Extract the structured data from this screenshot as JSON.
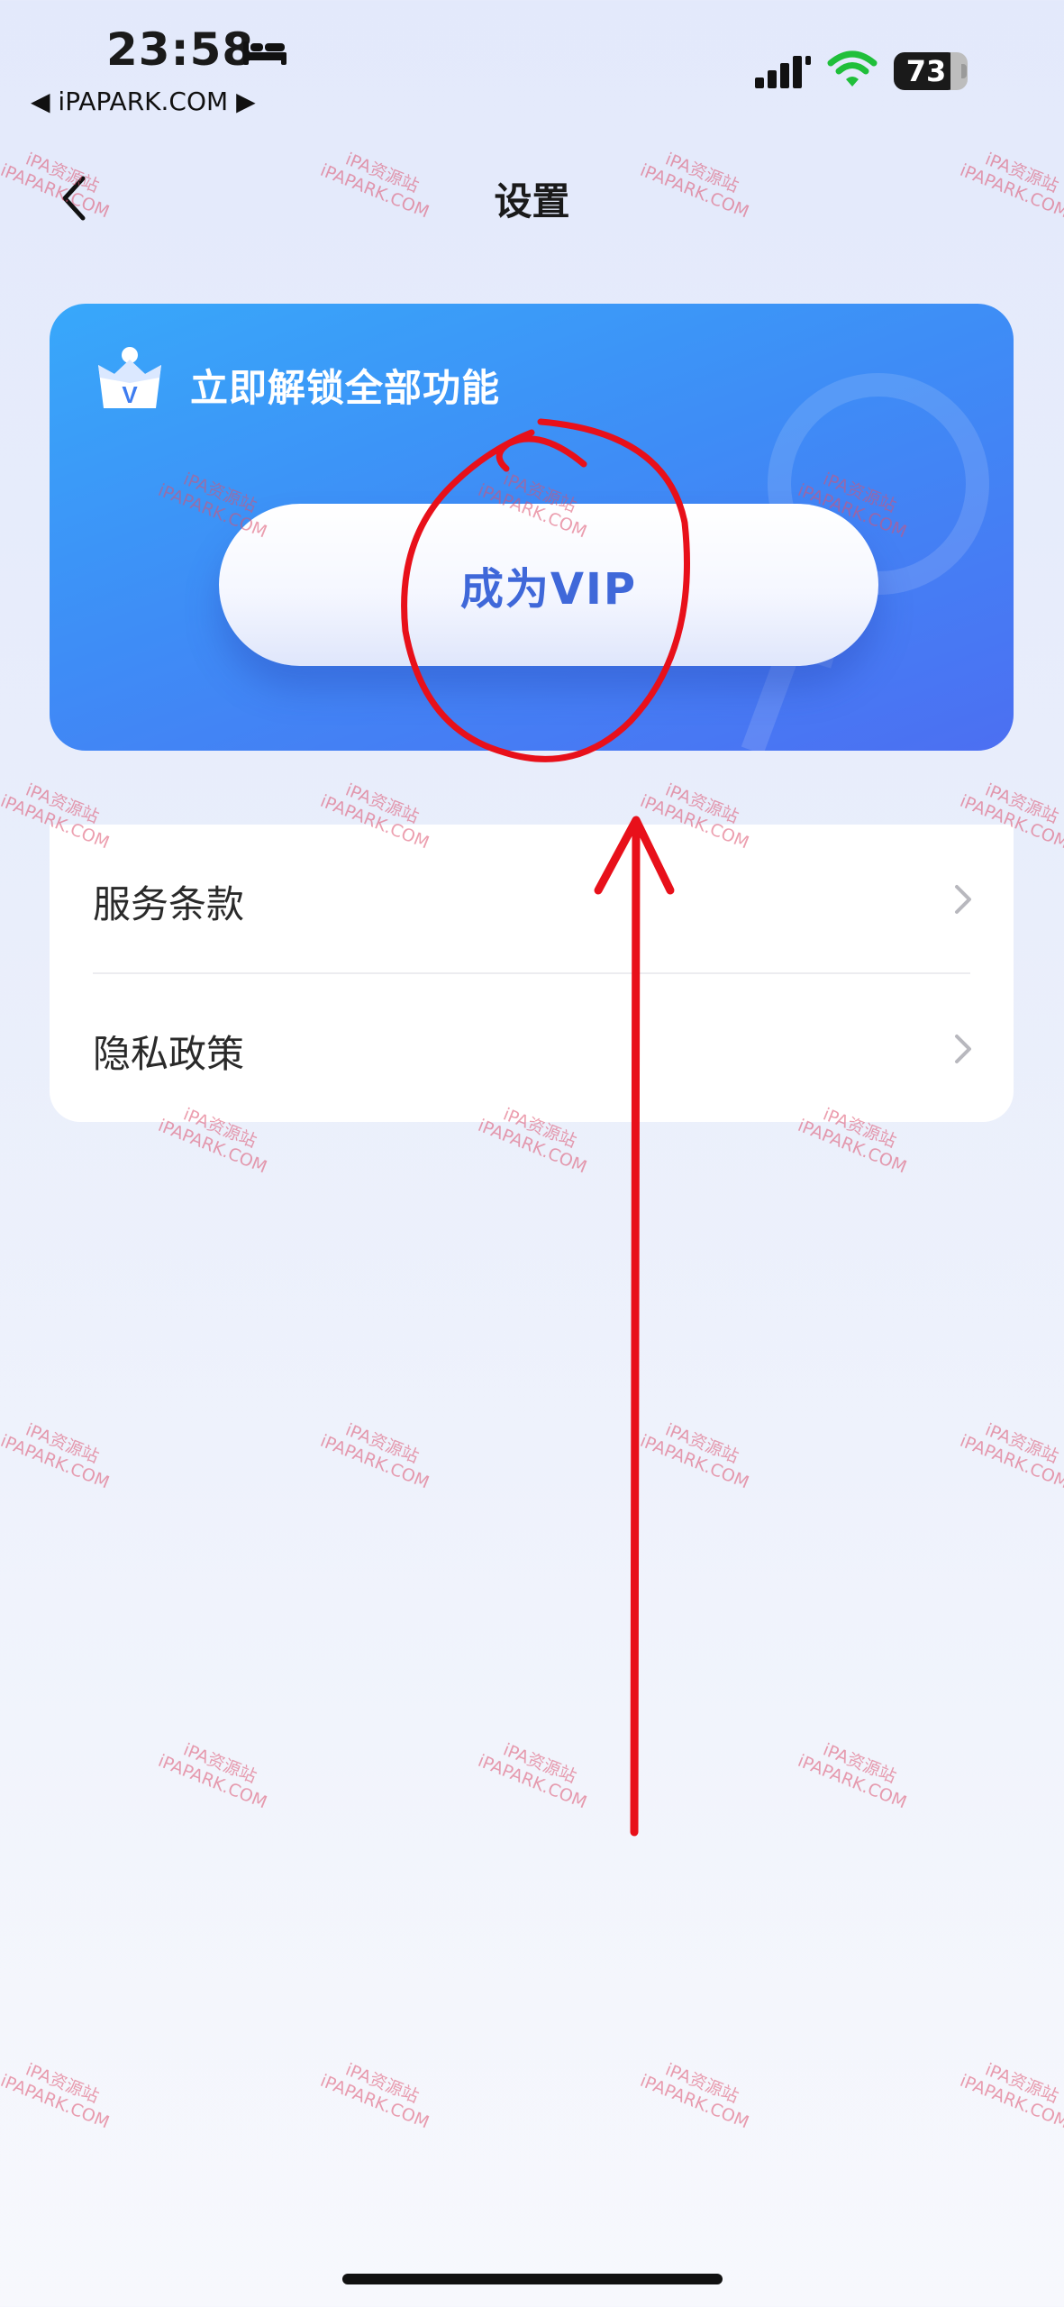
{
  "status_bar": {
    "time": "23:58",
    "back_app": "◀ iPAPARK.COM ▶",
    "battery": "73",
    "battery_level": 0.73,
    "icons": [
      "bed-icon",
      "signal-icon",
      "wifi-icon",
      "battery-icon"
    ]
  },
  "nav": {
    "title": "设置",
    "back_icon": "chevron-left-icon"
  },
  "vip_card": {
    "headline": "立即解锁全部功能",
    "button_label": "成为VIP",
    "icon": "crown-icon",
    "colors": {
      "gradient_start": "#38a8fa",
      "gradient_end": "#4c6ff2",
      "button_text": "#3f68d9"
    }
  },
  "settings": {
    "items": [
      {
        "label": "服务条款",
        "icon": "chevron-right-icon"
      },
      {
        "label": "隐私政策",
        "icon": "chevron-right-icon"
      }
    ]
  },
  "watermark": {
    "line1": "iPA资源站",
    "line2": "iPAPARK.COM"
  },
  "annotation": {
    "color": "#e8101a",
    "shapes": [
      "circle-around-vip-button",
      "upward-arrow"
    ]
  }
}
